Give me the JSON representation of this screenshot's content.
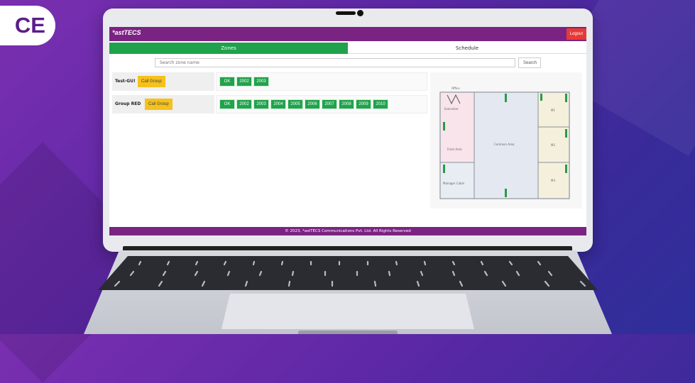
{
  "banner": {
    "text": "CE"
  },
  "app": {
    "brand": "*astTECS",
    "logout_label": "Logout",
    "tabs": [
      {
        "label": "Zones",
        "active": true
      },
      {
        "label": "Schedule",
        "active": false
      }
    ],
    "search": {
      "placeholder": "Search zone name",
      "button_label": "Search"
    },
    "groups": [
      {
        "name": "Test-GU!",
        "call_label": "Call Group",
        "zones": [
          "OK",
          "2002",
          "2003"
        ]
      },
      {
        "name": "Group RED",
        "call_label": "Call Group",
        "zones": [
          "OK",
          "2002",
          "2003",
          "2004",
          "2005",
          "2006",
          "2007",
          "2008",
          "2009",
          "2010"
        ]
      }
    ],
    "floorplan": {
      "rooms": [
        "Office",
        "Executive",
        "Front Area",
        "Manager Cabin",
        "Common Area",
        "M1",
        "M2",
        "M3"
      ]
    },
    "footer": "© 2023, *astTECS Communications Pvt. Ltd. All Rights Reserved"
  },
  "colors": {
    "header": "#7b2382",
    "tab_active": "#1fa24b",
    "zone_button": "#21a34c",
    "call_button": "#f5c11c",
    "logout": "#e73a35"
  }
}
